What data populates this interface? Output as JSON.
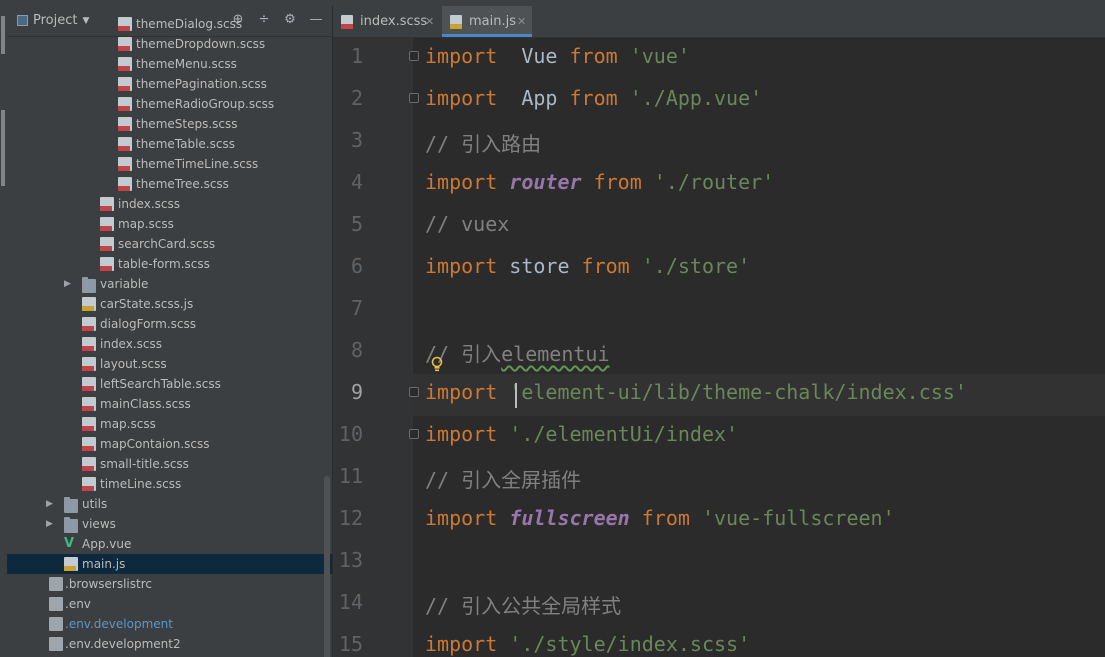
{
  "project_panel": {
    "title": "Project",
    "tree": [
      {
        "label": "themeDialog.scss",
        "icon": "sass-file-icon"
      },
      {
        "label": "themeDropdown.scss",
        "icon": "sass-file-icon"
      },
      {
        "label": "themeMenu.scss",
        "icon": "sass-file-icon"
      },
      {
        "label": "themePagination.scss",
        "icon": "sass-file-icon"
      },
      {
        "label": "themeRadioGroup.scss",
        "icon": "sass-file-icon"
      },
      {
        "label": "themeSteps.scss",
        "icon": "sass-file-icon"
      },
      {
        "label": "themeTable.scss",
        "icon": "sass-file-icon"
      },
      {
        "label": "themeTimeLine.scss",
        "icon": "sass-file-icon"
      },
      {
        "label": "themeTree.scss",
        "icon": "sass-file-icon"
      },
      {
        "label": "index.scss",
        "icon": "sass-file-icon"
      },
      {
        "label": "map.scss",
        "icon": "sass-file-icon"
      },
      {
        "label": "searchCard.scss",
        "icon": "sass-file-icon"
      },
      {
        "label": "table-form.scss",
        "icon": "sass-file-icon"
      },
      {
        "label": "variable",
        "icon": "folder-icon"
      },
      {
        "label": "carState.scss.js",
        "icon": "js-file-icon"
      },
      {
        "label": "dialogForm.scss",
        "icon": "sass-file-icon"
      },
      {
        "label": "index.scss",
        "icon": "sass-file-icon"
      },
      {
        "label": "layout.scss",
        "icon": "sass-file-icon"
      },
      {
        "label": "leftSearchTable.scss",
        "icon": "sass-file-icon"
      },
      {
        "label": "mainClass.scss",
        "icon": "sass-file-icon"
      },
      {
        "label": "map.scss",
        "icon": "sass-file-icon"
      },
      {
        "label": "mapContaion.scss",
        "icon": "sass-file-icon"
      },
      {
        "label": "small-title.scss",
        "icon": "sass-file-icon"
      },
      {
        "label": "timeLine.scss",
        "icon": "sass-file-icon"
      },
      {
        "label": "utils",
        "icon": "folder-icon"
      },
      {
        "label": "views",
        "icon": "folder-icon"
      },
      {
        "label": "App.vue",
        "icon": "vue-file-icon"
      },
      {
        "label": "main.js",
        "icon": "js-file-icon"
      },
      {
        "label": ".browserslistrc",
        "icon": "text-file-icon"
      },
      {
        "label": ".env",
        "icon": "text-file-icon"
      },
      {
        "label": ".env.development",
        "icon": "text-file-icon"
      },
      {
        "label": ".env.development2",
        "icon": "text-file-icon"
      }
    ]
  },
  "tabs": [
    {
      "label": "index.scss",
      "icon": "sass-file-icon",
      "active": false
    },
    {
      "label": "main.js",
      "icon": "js-file-icon",
      "active": true
    }
  ],
  "editor": {
    "current_line": 9,
    "lines": [
      {
        "n": "1",
        "t": [
          [
            "kw",
            "import"
          ],
          [
            "",
            "  Vue "
          ],
          [
            "kw",
            "from"
          ],
          [
            "str",
            " 'vue'"
          ]
        ]
      },
      {
        "n": "2",
        "t": [
          [
            "kw",
            "import"
          ],
          [
            "",
            "  App "
          ],
          [
            "kw",
            "from"
          ],
          [
            "str",
            " './App.vue'"
          ]
        ]
      },
      {
        "n": "3",
        "t": [
          [
            "cm",
            "// 引入路由"
          ]
        ]
      },
      {
        "n": "4",
        "t": [
          [
            "kw",
            "import"
          ],
          [
            "",
            " "
          ],
          [
            "it",
            "router"
          ],
          [
            "",
            " "
          ],
          [
            "kw",
            "from"
          ],
          [
            "str",
            " './router'"
          ]
        ]
      },
      {
        "n": "5",
        "t": [
          [
            "cm",
            "// vuex"
          ]
        ]
      },
      {
        "n": "6",
        "t": [
          [
            "kw",
            "import"
          ],
          [
            "",
            " store "
          ],
          [
            "kw",
            "from"
          ],
          [
            "str",
            " './store'"
          ]
        ]
      },
      {
        "n": "7",
        "t": []
      },
      {
        "n": "8",
        "t": [
          [
            "cm",
            "// 引入"
          ],
          [
            "cm typo",
            "elementui"
          ]
        ]
      },
      {
        "n": "9",
        "t": [
          [
            "kw",
            "import"
          ],
          [
            "",
            " "
          ],
          [
            "str",
            "'element-ui/lib/theme-chalk/index.css'"
          ]
        ]
      },
      {
        "n": "10",
        "t": [
          [
            "kw",
            "import"
          ],
          [
            "",
            " "
          ],
          [
            "str",
            "'./elementUi/index'"
          ]
        ]
      },
      {
        "n": "11",
        "t": [
          [
            "cm",
            "// 引入全屏插件"
          ]
        ]
      },
      {
        "n": "12",
        "t": [
          [
            "kw",
            "import"
          ],
          [
            "",
            " "
          ],
          [
            "it",
            "fullscreen"
          ],
          [
            "",
            " "
          ],
          [
            "kw",
            "from"
          ],
          [
            "str",
            " 'vue-fullscreen'"
          ]
        ]
      },
      {
        "n": "13",
        "t": []
      },
      {
        "n": "14",
        "t": [
          [
            "cm",
            "// 引入公共全局样式"
          ]
        ]
      },
      {
        "n": "15",
        "t": [
          [
            "kw",
            "import"
          ],
          [
            "",
            " "
          ],
          [
            "str",
            "'./style/index.scss'"
          ]
        ]
      }
    ]
  },
  "colors": {
    "background": "#2b2b2b",
    "panel": "#3c3f41",
    "keyword": "#cc7832",
    "string": "#6a8759",
    "comment": "#808080",
    "identifier_italic": "#9876aa",
    "selection": "#0d293e",
    "tab_accent": "#4a88c7"
  }
}
